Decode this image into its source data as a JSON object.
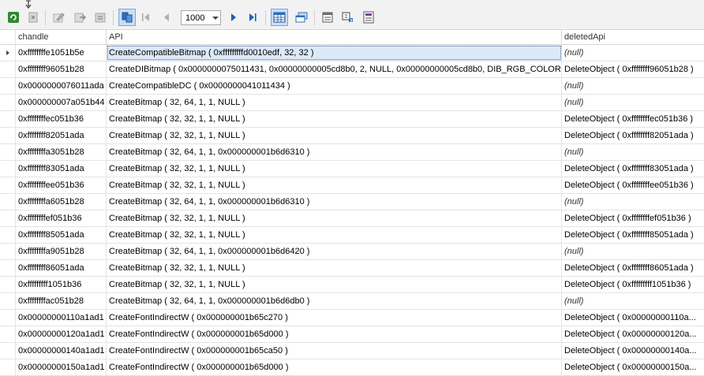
{
  "toolbar": {
    "page_size": "1000",
    "icons": [
      "refresh-icon",
      "clear-icon",
      "edit-icon",
      "export-icon",
      "export-alt-icon",
      "view-toggle-icon",
      "first-page-icon",
      "prev-page-icon",
      "next-page-icon",
      "last-page-icon",
      "grid-view-icon",
      "window-icon",
      "properties-icon",
      "replace-icon",
      "report-icon"
    ]
  },
  "grid": {
    "columns": [
      "chandle",
      "API",
      "deletedApi"
    ],
    "rows": [
      [
        "0xffffffffe1051b5e",
        "CreateCompatibleBitmap ( 0xfffffffffd0010edf, 32, 32 )",
        "(null)"
      ],
      [
        "0xffffffff96051b28",
        "CreateDIBitmap ( 0x0000000075011431, 0x00000000005cd8b0, 2, NULL, 0x00000000005cd8b0, DIB_RGB_COLORS )",
        "DeleteObject ( 0xffffffff96051b28 )"
      ],
      [
        "0x0000000076011ada",
        "CreateCompatibleDC ( 0x0000000041011434 )",
        "(null)"
      ],
      [
        "0x000000007a051b44",
        "CreateBitmap ( 32, 64, 1, 1, NULL )",
        "(null)"
      ],
      [
        "0xffffffffec051b36",
        "CreateBitmap ( 32, 32, 1, 1, NULL )",
        "DeleteObject ( 0xffffffffec051b36 )"
      ],
      [
        "0xffffffff82051ada",
        "CreateBitmap ( 32, 32, 1, 1, NULL )",
        "DeleteObject ( 0xffffffff82051ada )"
      ],
      [
        "0xffffffffa3051b28",
        "CreateBitmap ( 32, 64, 1, 1, 0x000000001b6d6310 )",
        "(null)"
      ],
      [
        "0xffffffff83051ada",
        "CreateBitmap ( 32, 32, 1, 1, NULL )",
        "DeleteObject ( 0xffffffff83051ada )"
      ],
      [
        "0xffffffffee051b36",
        "CreateBitmap ( 32, 32, 1, 1, NULL )",
        "DeleteObject ( 0xffffffffee051b36 )"
      ],
      [
        "0xffffffffa6051b28",
        "CreateBitmap ( 32, 64, 1, 1, 0x000000001b6d6310 )",
        "(null)"
      ],
      [
        "0xffffffffef051b36",
        "CreateBitmap ( 32, 32, 1, 1, NULL )",
        "DeleteObject ( 0xffffffffef051b36 )"
      ],
      [
        "0xffffffff85051ada",
        "CreateBitmap ( 32, 32, 1, 1, NULL )",
        "DeleteObject ( 0xffffffff85051ada )"
      ],
      [
        "0xffffffffa9051b28",
        "CreateBitmap ( 32, 64, 1, 1, 0x000000001b6d6420 )",
        "(null)"
      ],
      [
        "0xffffffff86051ada",
        "CreateBitmap ( 32, 32, 1, 1, NULL )",
        "DeleteObject ( 0xffffffff86051ada )"
      ],
      [
        "0xfffffffff1051b36",
        "CreateBitmap ( 32, 32, 1, 1, NULL )",
        "DeleteObject ( 0xfffffffff1051b36 )"
      ],
      [
        "0xffffffffac051b28",
        "CreateBitmap ( 32, 64, 1, 1, 0x000000001b6d6db0 )",
        "(null)"
      ],
      [
        "0x00000000110a1ad1",
        "CreateFontIndirectW ( 0x000000001b65c270 )",
        "DeleteObject ( 0x00000000110a..."
      ],
      [
        "0x00000000120a1ad1",
        "CreateFontIndirectW ( 0x000000001b65d000 )",
        "DeleteObject ( 0x00000000120a..."
      ],
      [
        "0x00000000140a1ad1",
        "CreateFontIndirectW ( 0x000000001b65ca50 )",
        "DeleteObject ( 0x00000000140a..."
      ],
      [
        "0x00000000150a1ad1",
        "CreateFontIndirectW ( 0x000000001b65d000 )",
        "DeleteObject ( 0x00000000150a..."
      ]
    ],
    "selected_row": 0
  }
}
